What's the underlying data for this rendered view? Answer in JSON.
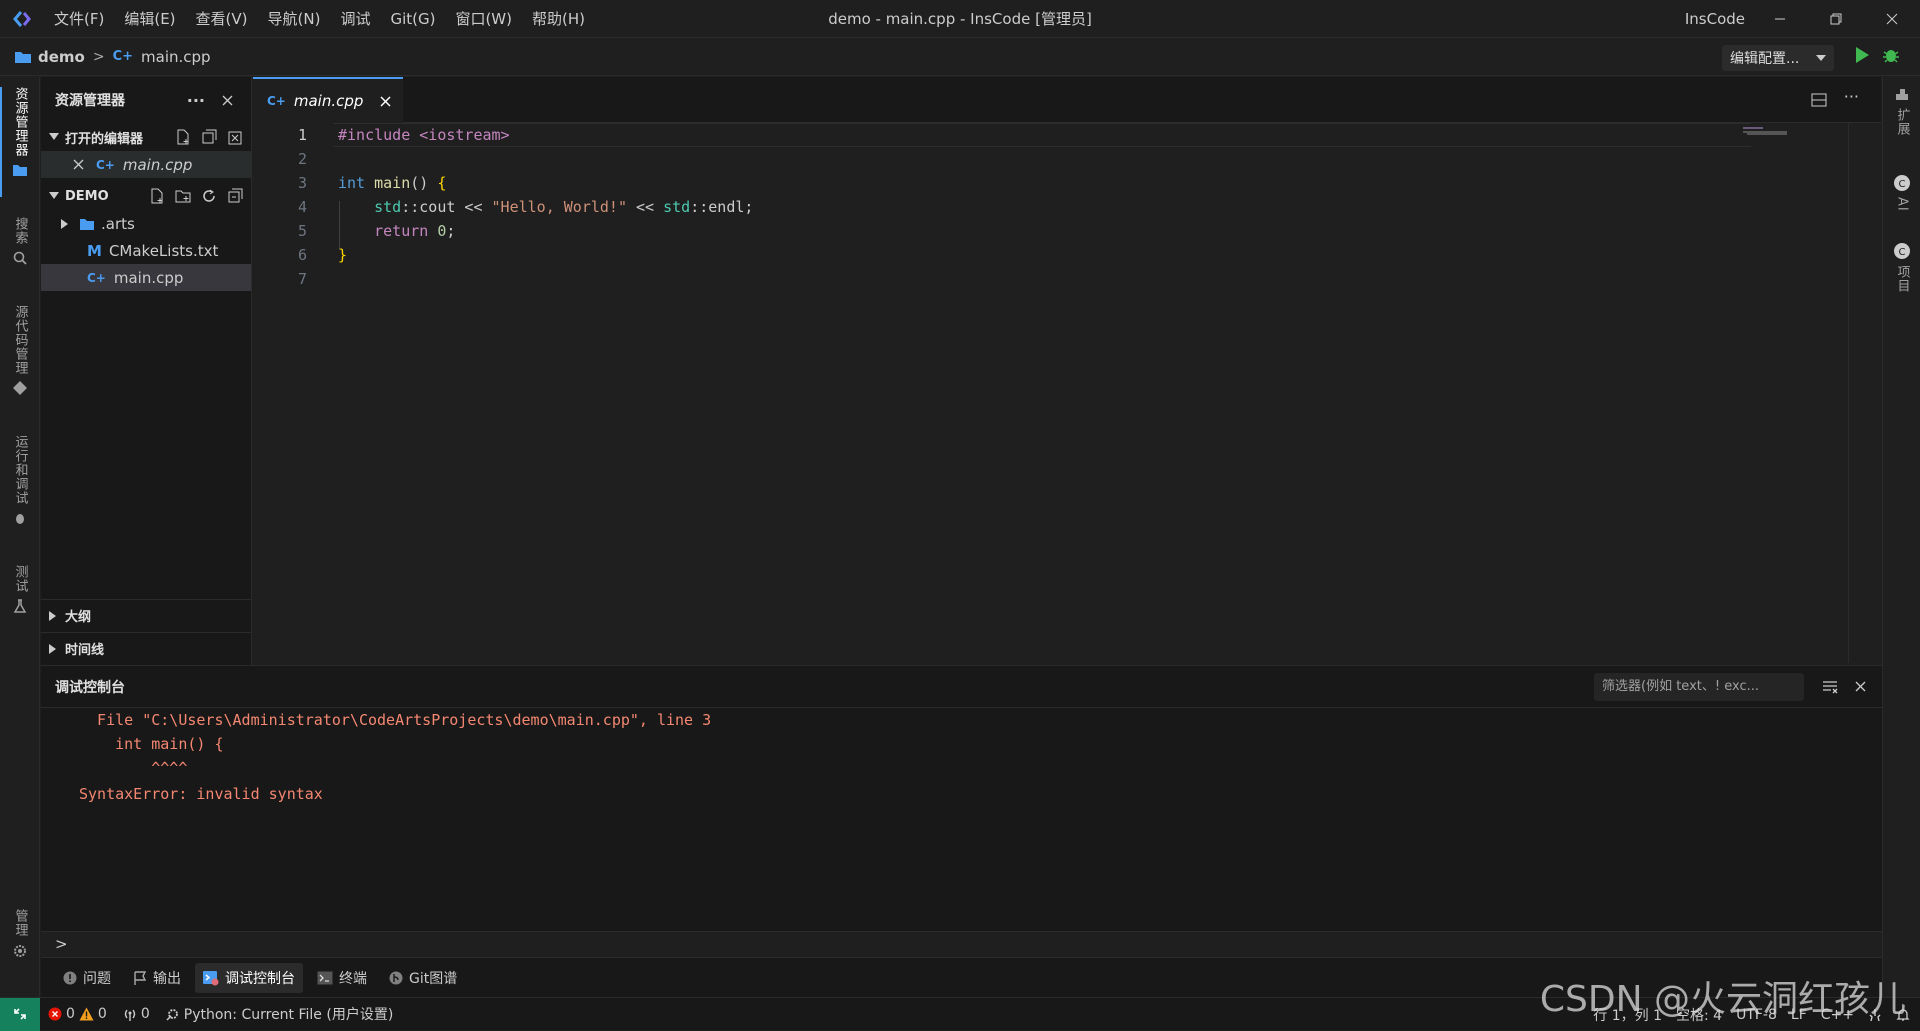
{
  "titlebar": {
    "menu": [
      "文件(F)",
      "编辑(E)",
      "查看(V)",
      "导航(N)",
      "调试",
      "Git(G)",
      "窗口(W)",
      "帮助(H)"
    ],
    "window_title": "demo - main.cpp - InsCode [管理员]",
    "brand": "InsCode"
  },
  "breadcrumb": {
    "project": "demo",
    "separator": ">",
    "file": "main.cpp"
  },
  "toolbar": {
    "run_config": "编辑配置..."
  },
  "activitybar": {
    "explorer": "资源管理器",
    "search": "搜索",
    "scm": "源代码管理",
    "run_debug": "运行和调试",
    "test": "测试",
    "manage": "管理"
  },
  "rightbar": {
    "extensions": "扩展",
    "ai": "AI",
    "project": "项目"
  },
  "sidebar": {
    "title": "资源管理器",
    "open_editors": "打开的编辑器",
    "open_editor_file": "main.cpp",
    "project_section": "DEMO",
    "files": [
      {
        "name": ".arts",
        "type": "folder"
      },
      {
        "name": "CMakeLists.txt",
        "type": "cmake"
      },
      {
        "name": "main.cpp",
        "type": "cpp"
      }
    ],
    "outline": "大纲",
    "timeline": "时间线"
  },
  "editor": {
    "tab_label": "main.cpp",
    "line_numbers": [
      "1",
      "2",
      "3",
      "4",
      "5",
      "6",
      "7"
    ],
    "lines": {
      "l1_pp": "#include <iostream>",
      "l3_kw": "int",
      "l3_fn": "main",
      "l3_rest": "() ",
      "l3_brace": "{",
      "l4_ns1": "std",
      "l4_op1": "::cout << ",
      "l4_str": "\"Hello, World!\"",
      "l4_op2": " << ",
      "l4_ns2": "std",
      "l4_end": "::endl;",
      "l5_kw": "return",
      "l5_num": "0",
      "l5_end": ";",
      "l6_brace": "}"
    }
  },
  "panel": {
    "title": "调试控制台",
    "filter_placeholder": "筛选器(例如 text、! exc...",
    "console": [
      "  File \"C:\\Users\\Administrator\\CodeArtsProjects\\demo\\main.cpp\", line 3",
      "    int main() {",
      "        ^^^^",
      "SyntaxError: invalid syntax"
    ],
    "prompt": ">"
  },
  "panel_tabs": [
    "问题",
    "输出",
    "调试控制台",
    "终端",
    "Git图谱"
  ],
  "statusbar": {
    "errors": "0",
    "warnings": "0",
    "ports": "0",
    "interpreter": "Python: Current File (用户设置)",
    "position": "行 1，列 1",
    "spaces": "空格: 4",
    "encoding": "UTF-8",
    "eol": "LF",
    "language": "C++"
  },
  "watermark": "CSDN @火云洞红孩儿",
  "colors": {
    "accent": "#4a9cf0",
    "error_text": "#f48771",
    "remote": "#16825d"
  }
}
